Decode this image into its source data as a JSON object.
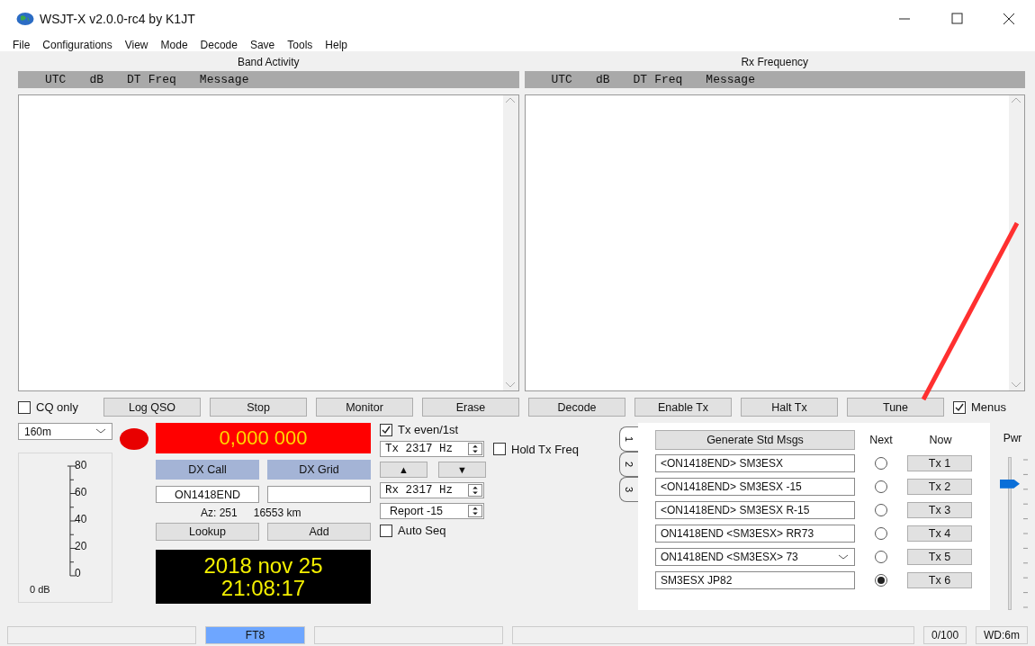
{
  "window": {
    "title": "WSJT-X  v2.0.0-rc4  by K1JT"
  },
  "menu": [
    "File",
    "Configurations",
    "View",
    "Mode",
    "Decode",
    "Save",
    "Tools",
    "Help"
  ],
  "panels": [
    {
      "title": "Band Activity",
      "columns": [
        "UTC",
        "dB",
        "DT",
        "Freq",
        "Message"
      ]
    },
    {
      "title": "Rx Frequency",
      "columns": [
        "UTC",
        "dB",
        "DT",
        "Freq",
        "Message"
      ]
    }
  ],
  "controls_row": [
    {
      "kind": "checkbox",
      "label": "CQ only",
      "checked": false
    },
    {
      "kind": "button",
      "label": "Log QSO"
    },
    {
      "kind": "button",
      "label": "Stop"
    },
    {
      "kind": "button",
      "label": "Monitor"
    },
    {
      "kind": "button",
      "label": "Erase"
    },
    {
      "kind": "button",
      "label": "Decode"
    },
    {
      "kind": "button",
      "label": "Enable Tx"
    },
    {
      "kind": "button",
      "label": "Halt Tx"
    },
    {
      "kind": "button",
      "label": "Tune"
    },
    {
      "kind": "checkbox",
      "label": "Menus",
      "checked": true
    }
  ],
  "band": "160m",
  "frequency": "0,000 000",
  "dx": {
    "call_label": "DX Call",
    "grid_label": "DX Grid",
    "call": "ON1418END",
    "az": "Az: 251",
    "distance": "16553 km",
    "lookup": "Lookup",
    "add": "Add"
  },
  "clock": {
    "date": "2018 nov 25",
    "time": "21:08:17"
  },
  "meter": {
    "ticks": [
      "80",
      "60",
      "40",
      "20",
      "0"
    ],
    "unit": "0 dB"
  },
  "tx_settings": {
    "tx_even": {
      "label": "Tx even/1st",
      "checked": true
    },
    "tx_freq": "Tx  2317 Hz",
    "hold_tx": {
      "label": "Hold Tx Freq",
      "checked": false
    },
    "up": "▲",
    "down": "▼",
    "rx_freq": "Rx  2317 Hz",
    "report": "Report -15",
    "auto_seq": {
      "label": "Auto Seq",
      "checked": false
    }
  },
  "tabs": [
    {
      "label": "1",
      "selected": true
    },
    {
      "label": "2",
      "selected": false
    },
    {
      "label": "3",
      "selected": false
    }
  ],
  "messages": {
    "generate": "Generate Std Msgs",
    "next_label": "Next",
    "now_label": "Now",
    "rows": [
      {
        "kind": "field",
        "text": "<ON1418END> SM3ESX",
        "selected": false,
        "button": "Tx 1"
      },
      {
        "kind": "field",
        "text": "<ON1418END> SM3ESX -15",
        "selected": false,
        "button": "Tx 2"
      },
      {
        "kind": "field",
        "text": "<ON1418END> SM3ESX R-15",
        "selected": false,
        "button": "Tx 3"
      },
      {
        "kind": "field",
        "text": "ON1418END <SM3ESX> RR73",
        "selected": false,
        "button": "Tx 4"
      },
      {
        "kind": "combo",
        "text": "ON1418END <SM3ESX> 73",
        "selected": false,
        "button": "Tx 5"
      },
      {
        "kind": "field",
        "text": "SM3ESX JP82",
        "selected": true,
        "button": "Tx 6"
      }
    ]
  },
  "power": {
    "label": "Pwr",
    "level": 0.85
  },
  "status_bar": {
    "mode": "FT8",
    "count": "0/100",
    "watchdog": "WD:6m"
  }
}
